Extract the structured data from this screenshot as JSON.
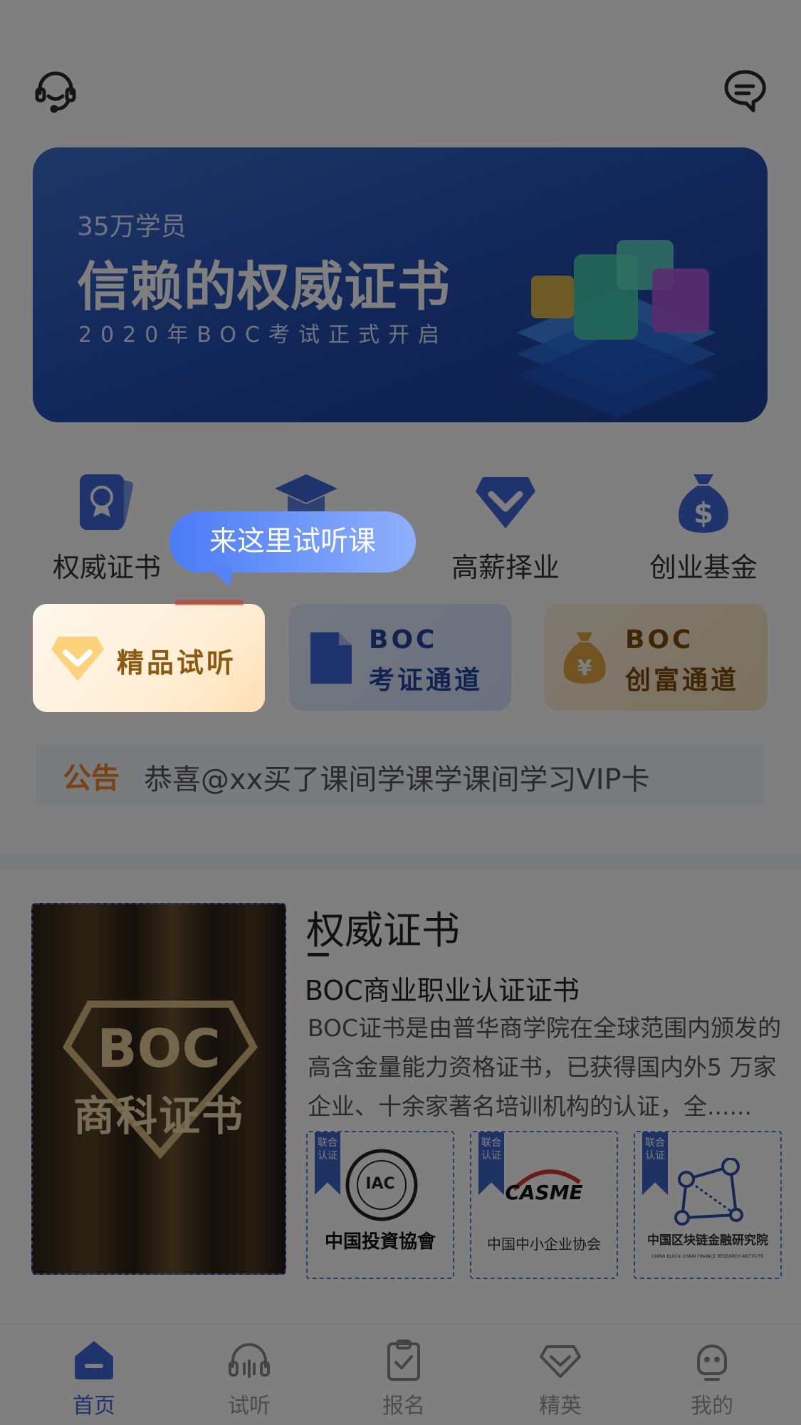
{
  "header": {
    "left_icon": "customer-service-icon",
    "right_icon": "message-icon"
  },
  "banner": {
    "subtitle": "35万学员",
    "title": "信赖的权威证书",
    "tagline": "2020年BOC考试正式开启"
  },
  "categories": [
    {
      "label": "权威证书",
      "icon": "certificate-icon"
    },
    {
      "label": "",
      "icon": "graduation-cap-icon"
    },
    {
      "label": "高薪择业",
      "icon": "diamond-icon"
    },
    {
      "label": "创业基金",
      "icon": "money-bag-icon"
    }
  ],
  "tooltip": {
    "text": "来这里试听课"
  },
  "cards": [
    {
      "label": "精品试听",
      "icon": "diamond-icon"
    },
    {
      "line1": "BOC",
      "line2": "考证通道",
      "icon": "document-icon"
    },
    {
      "line1": "BOC",
      "line2": "创富通道",
      "icon": "money-bag-icon"
    }
  ],
  "notice": {
    "tag": "公告",
    "message": "恭喜@xx买了课间学课学课间学习VIP卡"
  },
  "certificate": {
    "poster_line1": "BOC",
    "poster_line2": "商科证书",
    "title": "权威证书",
    "subtitle": "BOC商业职业认证证书",
    "description": "BOC证书是由普华商学院在全球范围内颁发的高含金量能力资格证书，已获得国内外5 万家企业、十余家著名培训机构的认证，全......",
    "orgs": [
      {
        "ribbon": "联合认证",
        "name": "中国投資協會",
        "logo_text": "IAC"
      },
      {
        "ribbon": "联合认证",
        "name": "中国中小企业协会",
        "logo_text": "CASME"
      },
      {
        "ribbon": "联合认证",
        "name": "中国区块链金融研究院",
        "sub": "CHINA BLOCK CHAIN FINANCE RESEARCH INSTITUTE"
      }
    ]
  },
  "nav": [
    {
      "label": "首页",
      "icon": "home-icon",
      "active": true
    },
    {
      "label": "试听",
      "icon": "headphones-icon",
      "active": false
    },
    {
      "label": "报名",
      "icon": "clipboard-check-icon",
      "active": false
    },
    {
      "label": "精英",
      "icon": "diamond-icon",
      "active": false
    },
    {
      "label": "我的",
      "icon": "profile-icon",
      "active": false
    }
  ],
  "colors": {
    "accent": "#3e66d8",
    "notice_tag": "#f0862d",
    "tooltip": "#4b7bf5"
  }
}
